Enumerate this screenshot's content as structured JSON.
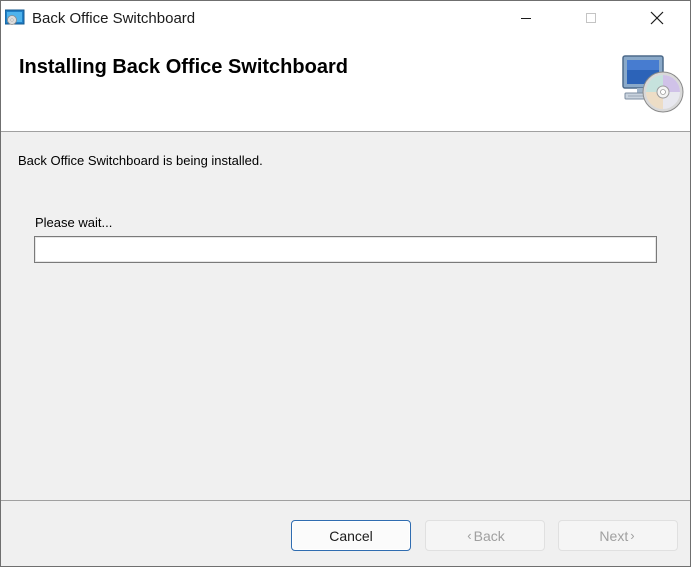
{
  "window": {
    "title": "Back Office Switchboard"
  },
  "titlebar": {
    "icons": [
      "installer-app-icon",
      "minimize-icon",
      "maximize-icon",
      "close-icon"
    ]
  },
  "banner": {
    "title": "Installing Back Office Switchboard",
    "icon": "computer-cd-icon"
  },
  "main": {
    "status": "Back Office Switchboard is being installed.",
    "wait_label": "Please wait...",
    "progress_value": 0
  },
  "footer": {
    "cancel_label": "Cancel",
    "back_label": "Back",
    "next_label": "Next",
    "back_enabled": false,
    "next_enabled": false
  },
  "colors": {
    "accent": "#2f6cb0",
    "progress_fill": "#06b025"
  }
}
